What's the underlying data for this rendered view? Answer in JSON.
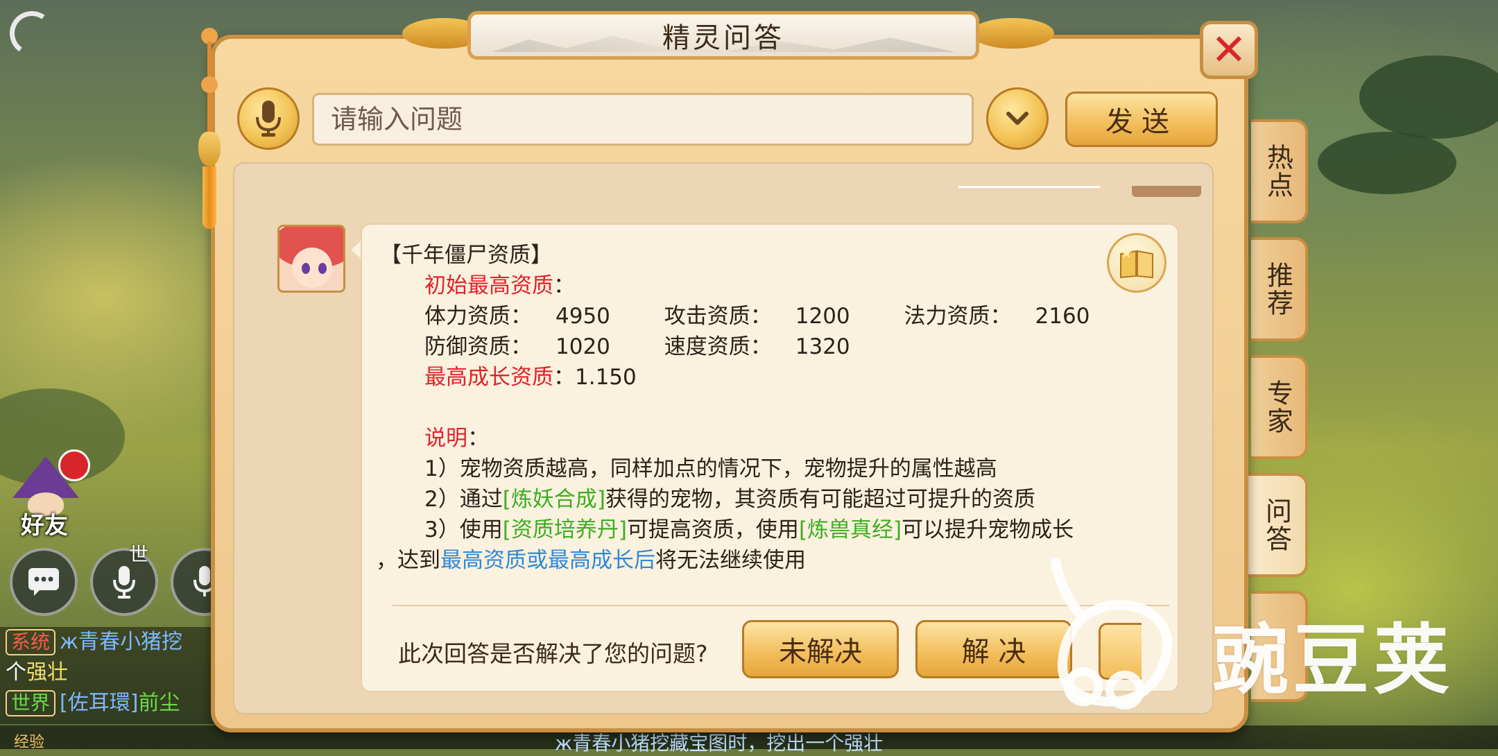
{
  "dialog": {
    "title": "精灵问答",
    "close_label": "✕",
    "input_placeholder": "请输入问题",
    "send_label": "发送"
  },
  "side_tabs": [
    {
      "label": "热点",
      "active": false
    },
    {
      "label": "推荐",
      "active": false
    },
    {
      "label": "专家",
      "active": false
    },
    {
      "label": "问答",
      "active": true
    }
  ],
  "answer": {
    "heading": "【千年僵尸资质】",
    "initial_title": "初始最高资质",
    "colon": "：",
    "stat_rows": [
      [
        {
          "label": "体力资质：",
          "value": "4950"
        },
        {
          "label": "攻击资质：",
          "value": "1200"
        },
        {
          "label": "法力资质：",
          "value": "2160"
        }
      ],
      [
        {
          "label": "防御资质：",
          "value": "1020"
        },
        {
          "label": "速度资质：",
          "value": "1320"
        }
      ]
    ],
    "growth_label": "最高成长资质",
    "growth_value": "：1.150",
    "note_title": "说明",
    "note1": "1）宠物资质越高，同样加点的情况下，宠物提升的属性越高",
    "note2_pre": "2）通过",
    "note2_link": "[炼妖合成]",
    "note2_post": "获得的宠物，其资质有可能超过可提升的资质",
    "note3_pre": "3）使用",
    "note3_link1": "[资质培养丹]",
    "note3_mid": "可提高资质，使用",
    "note3_link2": "[炼兽真经]",
    "note3_post": "可以提升宠物成长",
    "note4_pre": "，达到",
    "note4_link": "最高资质或最高成长后",
    "note4_post": "将无法继续使用"
  },
  "feedback": {
    "question": "此次回答是否解决了您的问题?",
    "unresolved_label": "未解决",
    "resolved_label": "解 决"
  },
  "hud": {
    "friend_label": "好友",
    "world_tag": "世",
    "exp_label": "经验",
    "chat": [
      {
        "tag": "系统",
        "pre": "ж青春小猪挖",
        "post": ""
      },
      {
        "tag": "",
        "pre": "个",
        "post": "强壮"
      },
      {
        "tag": "世界",
        "pre": "[佐耳環]",
        "post": "前尘"
      }
    ],
    "ticker": "ж青春小猪挖藏宝图时，挖出一个强壮"
  },
  "watermark": {
    "text": "豌豆荚"
  },
  "colors": {
    "accent_gold": "#f2bd5a",
    "frame": "#c88f42",
    "highlight_red": "#e0232a",
    "highlight_green": "#3cae1f",
    "highlight_blue": "#2d8ad9"
  },
  "icons": [
    "microphone-icon",
    "chevron-down-icon",
    "close-icon",
    "book-icon",
    "chat-bubble-icon",
    "voice-icon"
  ]
}
